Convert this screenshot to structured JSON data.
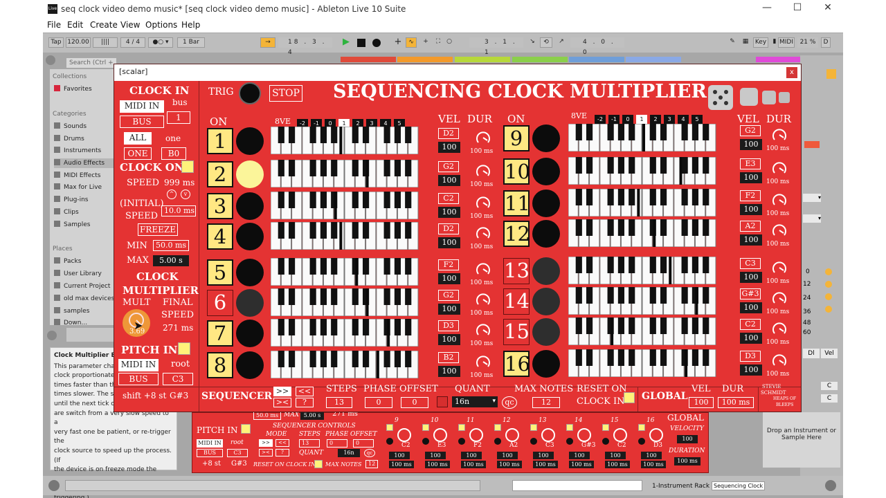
{
  "window": {
    "title": "seq clock video demo music*  [seq clock video demo music] - Ableton Live 10 Suite",
    "app_badge": "Live",
    "minimize": "—",
    "maximize": "☐",
    "close": "✕"
  },
  "menu": [
    "File",
    "Edit",
    "Create",
    "View",
    "Options",
    "Help"
  ],
  "transport": {
    "tap": "Tap",
    "tempo": "120.00",
    "time_sig": "4 / 4",
    "quant": "1 Bar",
    "position": "18 . 3 . 4",
    "loop_start": "3 . 1 . 1",
    "loop_len": "4 . 0 . 0",
    "key": "Key",
    "midi": "MIDI",
    "cpu": "21 %",
    "d": "D"
  },
  "browser": {
    "search_placeholder": "Search (Ctrl + F)",
    "collections_label": "Collections",
    "favorites": "Favorites",
    "categories_label": "Categories",
    "categories": [
      "Sounds",
      "Drums",
      "Instruments",
      "Audio Effects",
      "MIDI Effects",
      "Max for Live",
      "Plug-ins",
      "Clips",
      "Samples"
    ],
    "places_label": "Places",
    "places": [
      "Packs",
      "User Library",
      "Current Project",
      "old max devices",
      "samples",
      "Down..."
    ]
  },
  "info": {
    "title": "Clock Multiplier Big",
    "lines": [
      "This parameter chang",
      "clock proportionately",
      "times faster than the",
      "times slower. The sp",
      "until the next tick of",
      "are switch from a very slow speed to a",
      "very fast one be patient, or re-trigger the",
      "clock source to speed up the process. (If",
      "the device is on freeze mode the clock",
      "speed wont change with re-triggering.)"
    ]
  },
  "dropzone": "Drop an Instrument or Sample Here",
  "bottom": {
    "rack": "1-Instrument Rack",
    "device": "Sequencing Clock"
  },
  "scalar": {
    "title": "[scalar]",
    "close": "x",
    "device_title": "SEQUENCING CLOCK MULTIPLIER",
    "trig": "TRIG",
    "stop": "STOP",
    "clock_in": {
      "header": "CLOCK IN",
      "midi_in": "MIDI IN",
      "bus_label": "bus",
      "bus_btn": "BUS",
      "bus_val": "1",
      "all": "ALL",
      "one_label": "one",
      "one_btn": "ONE",
      "one_val": "B0"
    },
    "clock_on": {
      "header": "CLOCK ON",
      "speed_label": "SPEED",
      "speed_value": "999 ms",
      "initial_label": "(INITIAL)",
      "speed_label2": "SPEED",
      "initial_value": "10.0 ms",
      "freeze": "FREEZE",
      "min_label": "MIN",
      "min_value": "50.0 ms",
      "max_label": "MAX",
      "max_value": "5.00 s"
    },
    "multiplier": {
      "header1": "CLOCK",
      "header2": "MULTIPLIER",
      "mult_label": "MULT",
      "final_label": "FINAL",
      "speed_label": "SPEED",
      "final_value": "271 ms",
      "mult_value": "3.69"
    },
    "pitch_in": {
      "header": "PITCH IN",
      "midi_in": "MIDI IN",
      "root_label": "root",
      "bus_btn": "BUS",
      "root_value": "C3",
      "shift": "shift +8 st",
      "key": "G#3"
    },
    "headers": {
      "on": "ON",
      "octave": "8VE",
      "vel": "VEL",
      "dur": "DUR"
    },
    "octave_options": [
      "-2",
      "-1",
      "0",
      "1",
      "2",
      "3",
      "4",
      "5"
    ],
    "octave_selected": "1",
    "steps": [
      {
        "n": "1",
        "on": true,
        "led": "off",
        "note": "D2",
        "vel": "100",
        "dur": "100 ms",
        "key": 13
      },
      {
        "n": "2",
        "on": true,
        "led": "lit",
        "note": "G2",
        "vel": "100",
        "dur": "100 ms",
        "key": 18
      },
      {
        "n": "3",
        "on": true,
        "led": "off",
        "note": "C2",
        "vel": "100",
        "dur": "100 ms",
        "key": 12
      },
      {
        "n": "4",
        "on": true,
        "led": "off",
        "note": "D2",
        "vel": "100",
        "dur": "100 ms",
        "key": 13
      },
      {
        "n": "5",
        "on": true,
        "led": "off",
        "note": "F2",
        "vel": "100",
        "dur": "100 ms",
        "key": 16
      },
      {
        "n": "6",
        "on": false,
        "led": "dim",
        "note": "G2",
        "vel": "100",
        "dur": "100 ms",
        "key": 18
      },
      {
        "n": "7",
        "on": true,
        "led": "off",
        "note": "D3",
        "vel": "100",
        "dur": "100 ms",
        "key": 22
      },
      {
        "n": "8",
        "on": true,
        "led": "off",
        "note": "B2",
        "vel": "100",
        "dur": "100 ms",
        "key": 20
      },
      {
        "n": "9",
        "on": true,
        "led": "off",
        "note": "G2",
        "vel": "100",
        "dur": "100 ms",
        "key": 14
      },
      {
        "n": "10",
        "on": true,
        "led": "off",
        "note": "E3",
        "vel": "100",
        "dur": "100 ms",
        "key": 21
      },
      {
        "n": "11",
        "on": true,
        "led": "off",
        "note": "F2",
        "vel": "100",
        "dur": "100 ms",
        "key": 13
      },
      {
        "n": "12",
        "on": true,
        "led": "off",
        "note": "A2",
        "vel": "100",
        "dur": "100 ms",
        "key": 16
      },
      {
        "n": "13",
        "on": false,
        "led": "dim",
        "note": "C3",
        "vel": "100",
        "dur": "100 ms",
        "key": 19
      },
      {
        "n": "14",
        "on": false,
        "led": "dim",
        "note": "G#3",
        "vel": "100",
        "dur": "100 ms",
        "key": 24
      },
      {
        "n": "15",
        "on": false,
        "led": "dim",
        "note": "C2",
        "vel": "100",
        "dur": "100 ms",
        "key": 8
      },
      {
        "n": "16",
        "on": true,
        "led": "off",
        "note": "D3",
        "vel": "100",
        "dur": "100 ms",
        "key": 22
      }
    ],
    "sequencer": {
      "label": "SEQUENCER",
      "fwd": ">>",
      "back": "<<",
      "pingpong": "><",
      "random": "?",
      "steps_label": "STEPS",
      "steps_value": "13",
      "phase_label": "PHASE",
      "phase_value": "0",
      "offset_label": "OFFSET",
      "offset_value": "0",
      "quant_label": "QUANT",
      "quant_value": "16n",
      "qc": "qc",
      "maxnotes_label": "MAX NOTES",
      "maxnotes_value": "12",
      "reset_label1": "RESET ON",
      "reset_label2": "CLOCK IN"
    },
    "global": {
      "label": "GLOBAL",
      "vel_label": "VEL",
      "vel_value": "100",
      "dur_label": "DUR",
      "dur_value": "100 ms",
      "credit1": "STEVIE",
      "credit2": "SCHMIDT",
      "credit3": "HEAPS OF",
      "credit4": "BLEEPS"
    }
  },
  "underdevice": {
    "pitch_in": "PITCH IN",
    "midi_in": "MIDI IN",
    "root": "root",
    "bus": "BUS",
    "root_val": "C3",
    "shift": "+8 st",
    "key": "G#3",
    "min_val": "50.0 ms",
    "max_label": "MAX",
    "max_val": "5.00 s",
    "final_val": "271 ms",
    "seq_controls": "SEQUENCER CONTROLS",
    "mode": "MODE",
    "steps": "STEPS",
    "phase": "PHASE",
    "offset": "OFFSET",
    "steps_val": "13",
    "phase_val": "0",
    "offset_val": "0",
    "quant": "QUANT",
    "quant_val": "16n",
    "qc": "qc",
    "reset": "RESET ON CLOCK IN",
    "max_notes": "MAX NOTES",
    "max_notes_val": "12",
    "global": "GLOBAL",
    "velocity": "VELOCITY",
    "vel_val": "100",
    "duration": "DURATION",
    "dur_val": "100 ms",
    "step_nums": [
      "9",
      "10",
      "11",
      "12",
      "13",
      "14",
      "15",
      "16"
    ],
    "step_notes": [
      "C2",
      "E3",
      "F2",
      "A2",
      "C3",
      "G#3",
      "C2",
      "D3"
    ],
    "step_vel": "100",
    "step_dur": "100 ms"
  },
  "right_panel": {
    "dl": "Dl",
    "vel": "Vel",
    "c1": "C",
    "c2": "C",
    "nums": [
      "0",
      "12",
      "24",
      "36",
      "48",
      "60"
    ]
  },
  "colors": {
    "device_red": "#e43333",
    "step_yellow": "#ffe883",
    "led_lit": "#fbf59a"
  }
}
